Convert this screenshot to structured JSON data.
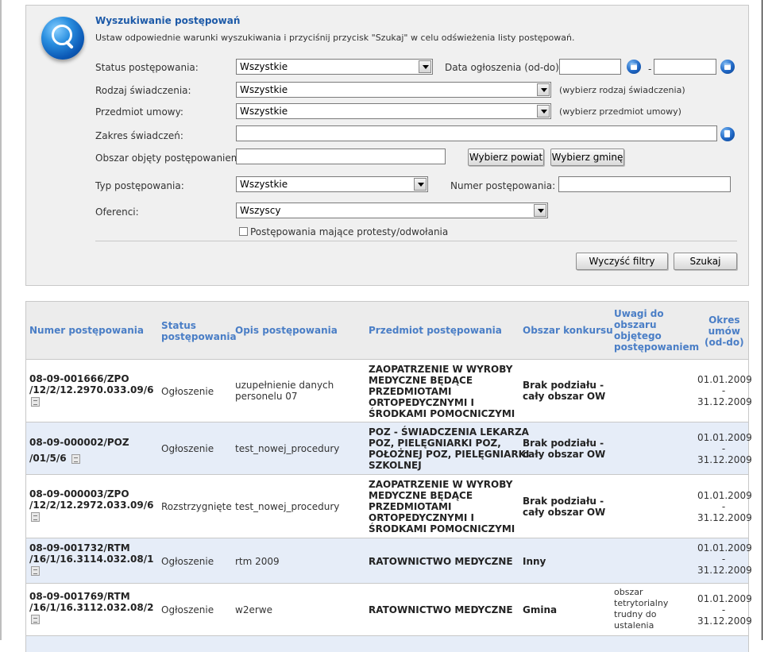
{
  "search": {
    "title": "Wyszukiwanie postępowań",
    "description": "Ustaw odpowiednie warunki wyszukiwania i przyciśnij przycisk \"Szukaj\" w celu odświeżenia listy postępowań.",
    "status_label": "Status postępowania:",
    "status_value": "Wszystkie",
    "date_label": "Data ogłoszenia (od-do):",
    "date_from": "",
    "date_to": "",
    "date_separator": "-",
    "rodzaj_label": "Rodzaj świadczenia:",
    "rodzaj_value": "Wszystkie",
    "rodzaj_hint": "(wybierz rodzaj świadczenia)",
    "przedmiot_label": "Przedmiot umowy:",
    "przedmiot_value": "Wszystkie",
    "przedmiot_hint": "(wybierz przedmiot umowy)",
    "zakres_label": "Zakres świadczeń:",
    "zakres_value": "",
    "obszar_label": "Obszar objęty postępowaniem:",
    "obszar_value": "",
    "wybierz_powiat": "Wybierz powiat",
    "wybierz_gmine": "Wybierz gminę",
    "typ_label": "Typ postępowania:",
    "typ_value": "Wszystkie",
    "numer_label": "Numer postępowania:",
    "numer_value": "",
    "oferenci_label": "Oferenci:",
    "oferenci_value": "Wszyscy",
    "protesty_label": "Postępowania mające protesty/odwołania",
    "clear_button": "Wyczyść filtry",
    "search_button": "Szukaj"
  },
  "table": {
    "headers": {
      "numer": "Numer postępowania",
      "status_l1": "Status",
      "status_l2": "postępowania",
      "opis": "Opis postępowania",
      "przedmiot": "Przedmiot postępowania",
      "obszar": "Obszar konkursu",
      "uwagi_l1": "Uwagi do",
      "uwagi_l2": "obszaru",
      "uwagi_l3": "objętego",
      "uwagi_l4": "postępowaniem",
      "okres_l1": "Okres",
      "okres_l2": "umów",
      "okres_l3": "(od-do)"
    },
    "rows": [
      {
        "numer_l1": "08-09-001666/ZPO",
        "numer_l2": "/12/2/12.2970.033.09/6",
        "status": "Ogłoszenie",
        "opis_l1": "uzupełnienie danych",
        "opis_l2": "personelu 07",
        "przedmiot_l1": "ZAOPATRZENIE W WYROBY",
        "przedmiot_l2": "MEDYCZNE BĘDĄCE",
        "przedmiot_l3": "PRZEDMIOTAMI",
        "przedmiot_l4": "ORTOPEDYCZNYMI I",
        "przedmiot_l5": "ŚRODKAMI POMOCNICZYMI",
        "obszar_l1": "Brak podziału -",
        "obszar_l2": "cały obszar OW",
        "uwagi": "",
        "od": "01.01.2009",
        "sep": "-",
        "do": "31.12.2009"
      },
      {
        "numer_l1": "08-09-000002/POZ",
        "numer_l2": "/01/5/6",
        "status": "Ogłoszenie",
        "opis_l1": "test_nowej_procedury",
        "przedmiot_l1": "POZ - ŚWIADCZENIA LEKARZA",
        "przedmiot_l2": "POZ, PIELĘGNIARKI POZ,",
        "przedmiot_l3": "POŁOŻNEJ POZ, PIELĘGNIARKI",
        "przedmiot_l4": "SZKOLNEJ",
        "obszar_l1": "Brak podziału -",
        "obszar_l2": "cały obszar OW",
        "uwagi": "",
        "od": "01.01.2009",
        "sep": "-",
        "do": "31.12.2009"
      },
      {
        "numer_l1": "08-09-000003/ZPO",
        "numer_l2": "/12/2/12.2972.033.09/6",
        "status": "Rozstrzygnięte",
        "opis_l1": "test_nowej_procedury",
        "przedmiot_l1": "ZAOPATRZENIE W WYROBY",
        "przedmiot_l2": "MEDYCZNE BĘDĄCE",
        "przedmiot_l3": "PRZEDMIOTAMI",
        "przedmiot_l4": "ORTOPEDYCZNYMI I",
        "przedmiot_l5": "ŚRODKAMI POMOCNICZYMI",
        "obszar_l1": "Brak podziału -",
        "obszar_l2": "cały obszar OW",
        "uwagi": "",
        "od": "01.01.2009",
        "sep": "-",
        "do": "31.12.2009"
      },
      {
        "numer_l1": "08-09-001732/RTM",
        "numer_l2": "/16/1/16.3114.032.08/1",
        "status": "Ogłoszenie",
        "opis_l1": "rtm 2009",
        "przedmiot_l1": "RATOWNICTWO MEDYCZNE",
        "obszar_l1": "Inny",
        "uwagi": "",
        "od": "01.01.2009",
        "sep": "-",
        "do": "31.12.2009"
      },
      {
        "numer_l1": "08-09-001769/RTM",
        "numer_l2": "/16/1/16.3112.032.08/2",
        "status": "Ogłoszenie",
        "opis_l1": "w2erwe",
        "przedmiot_l1": "RATOWNICTWO MEDYCZNE",
        "obszar_l1": "Gmina",
        "uwagi_l1": "obszar",
        "uwagi_l2": "tetrytorialny",
        "uwagi_l3": "trudny do",
        "uwagi_l4": "ustalenia",
        "od": "01.01.2009",
        "sep": "-",
        "do": "31.12.2009"
      }
    ]
  }
}
